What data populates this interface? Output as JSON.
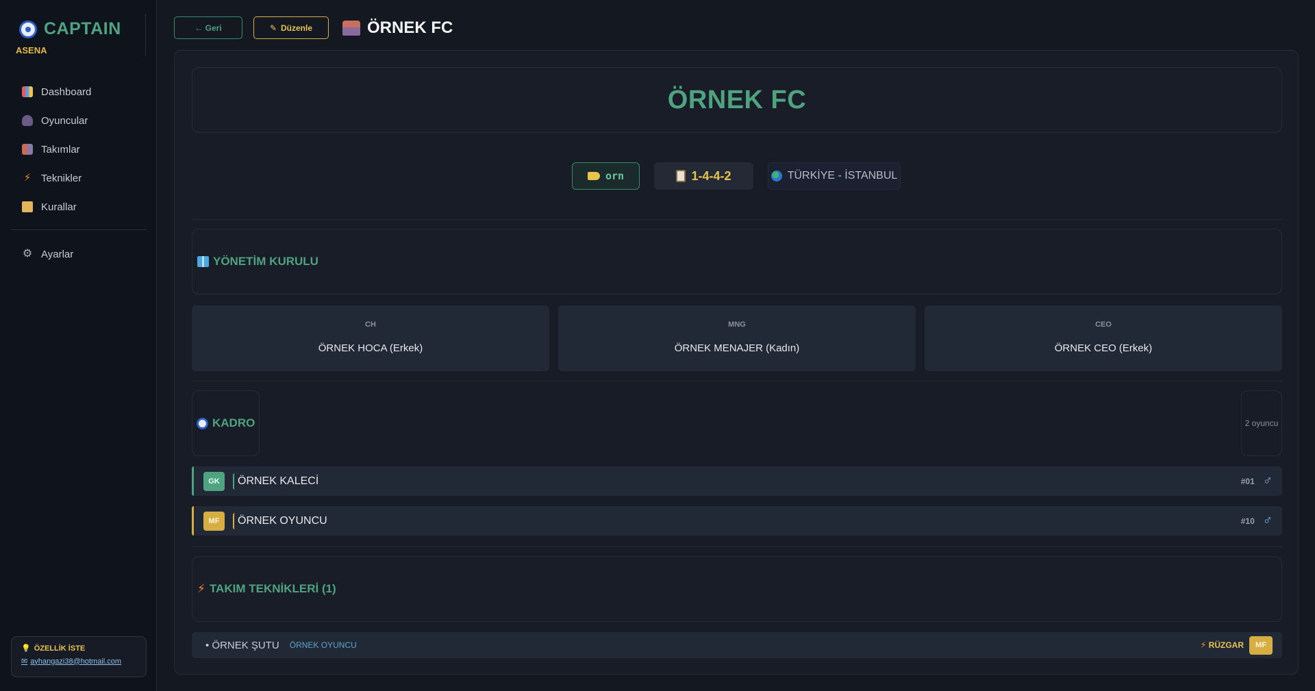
{
  "app": {
    "title": "CAPTAIN",
    "subtitle": "ASENA"
  },
  "sidebar": {
    "items": [
      {
        "label": "Dashboard",
        "icon": "chart-icon"
      },
      {
        "label": "Oyuncular",
        "icon": "player-icon"
      },
      {
        "label": "Takımlar",
        "icon": "stadium-icon"
      },
      {
        "label": "Teknikler",
        "icon": "bolt-icon"
      },
      {
        "label": "Kurallar",
        "icon": "scroll-icon"
      }
    ],
    "settings": {
      "label": "Ayarlar",
      "icon": "gear-icon"
    },
    "feature_request": {
      "title": "ÖZELLİK İSTE",
      "email": "ayhangazi38@hotmail.com"
    }
  },
  "toolbar": {
    "back_label": "← Geri",
    "edit_label": "Düzenle",
    "title": "ÖRNEK FC"
  },
  "team": {
    "name": "ÖRNEK FC",
    "code": "orn",
    "formation": "1-4-4-2",
    "location": "TÜRKİYE - İSTANBUL"
  },
  "board": {
    "title": "YÖNETİM KURULU",
    "members": [
      {
        "role": "CH",
        "name": "ÖRNEK HOCA (Erkek)"
      },
      {
        "role": "MNG",
        "name": "ÖRNEK MENAJER (Kadın)"
      },
      {
        "role": "CEO",
        "name": "ÖRNEK CEO (Erkek)"
      }
    ]
  },
  "squad": {
    "title": "KADRO",
    "count": "2 oyuncu",
    "players": [
      {
        "position": "GK",
        "name": "ÖRNEK KALECİ",
        "number": "#01",
        "gender": "♂"
      },
      {
        "position": "MF",
        "name": "ÖRNEK OYUNCU",
        "number": "#10",
        "gender": "♂"
      }
    ]
  },
  "techniques": {
    "title": "TAKIM TEKNİKLERİ (1)",
    "items": [
      {
        "name": "• ÖRNEK ŞUTU",
        "owner": "ÖRNEK OYUNCU",
        "type": "RÜZGAR",
        "position": "MF"
      }
    ]
  },
  "colors": {
    "accent_green": "#4fa381",
    "accent_gold": "#e8c34e",
    "background": "#141821"
  }
}
